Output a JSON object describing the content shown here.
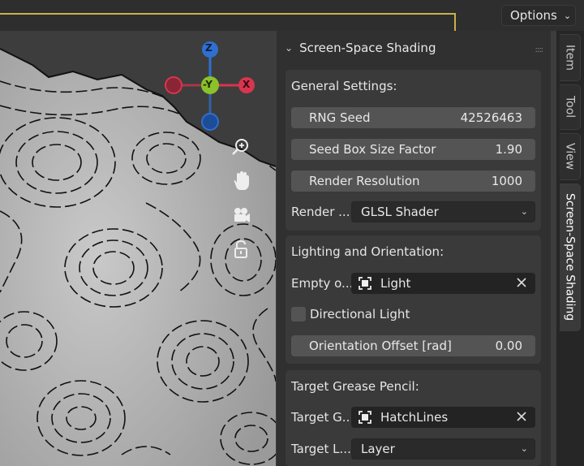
{
  "header": {
    "options_label": "Options"
  },
  "gizmo": {
    "axes": [
      {
        "label": "Z",
        "color": "#2f6fd1"
      },
      {
        "label": "-Y",
        "color": "#8bc12a"
      },
      {
        "label": "X",
        "color": "#d8354e"
      }
    ]
  },
  "panel": {
    "title": "Screen-Space Shading",
    "general": {
      "title": "General Settings:",
      "rng_seed_label": "RNG Seed",
      "rng_seed_value": "42526463",
      "seed_box_label": "Seed Box Size Factor",
      "seed_box_value": "1.90",
      "render_res_label": "Render Resolution",
      "render_res_value": "1000",
      "render_mode_label": "Render ...",
      "render_mode_value": "GLSL Shader"
    },
    "lighting": {
      "title": "Lighting and Orientation:",
      "empty_label": "Empty o...",
      "empty_value": "Light",
      "directional_label": "Directional Light",
      "directional_checked": false,
      "offset_label": "Orientation Offset [rad]",
      "offset_value": "0.00"
    },
    "target": {
      "title": "Target Grease Pencil:",
      "gp_label": "Target G...",
      "gp_value": "HatchLines",
      "layer_label": "Target L...",
      "layer_value": "Layer"
    }
  },
  "tabs": [
    "Item",
    "Tool",
    "View",
    "Screen-Space Shading"
  ],
  "colors": {
    "accent_frame": "#c9b14a",
    "panel_bg": "#303030",
    "field_bg": "#545454"
  }
}
